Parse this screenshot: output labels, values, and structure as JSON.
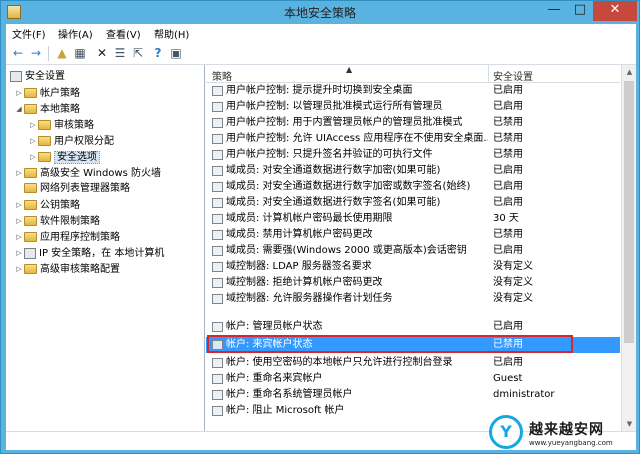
{
  "window": {
    "title": "本地安全策略",
    "min_glyph": "—",
    "max_glyph": "□",
    "close_glyph": "✕"
  },
  "menu": [
    "文件(F)",
    "操作(A)",
    "查看(V)",
    "帮助(H)"
  ],
  "toolbar": {
    "back": "←",
    "forward": "→",
    "up": "▲",
    "view": "▦",
    "delete": "✕",
    "properties": "☰",
    "export": "⇱",
    "help": "?",
    "pane": "▣"
  },
  "tree": {
    "root": "安全设置",
    "items": [
      {
        "label": "帐户策略"
      },
      {
        "label": "本地策略"
      },
      {
        "label": "审核策略"
      },
      {
        "label": "用户权限分配"
      },
      {
        "label": "安全选项"
      },
      {
        "label": "高级安全 Windows 防火墙"
      },
      {
        "label": "网络列表管理器策略"
      },
      {
        "label": "公钥策略"
      },
      {
        "label": "软件限制策略"
      },
      {
        "label": "应用程序控制策略"
      },
      {
        "label": "IP 安全策略，在 本地计算机"
      },
      {
        "label": "高级审核策略配置"
      }
    ]
  },
  "list": {
    "header_policy": "策略",
    "header_setting": "安全设置",
    "sort_glyph": "▲",
    "rows": [
      {
        "name": "用户帐户控制: 提示提升时切换到安全桌面",
        "value": "已启用"
      },
      {
        "name": "用户帐户控制: 以管理员批准模式运行所有管理员",
        "value": "已启用"
      },
      {
        "name": "用户帐户控制: 用于内置管理员帐户的管理员批准模式",
        "value": "已禁用"
      },
      {
        "name": "用户帐户控制: 允许 UIAccess 应用程序在不使用安全桌面...",
        "value": "已禁用"
      },
      {
        "name": "用户帐户控制: 只提升签名并验证的可执行文件",
        "value": "已禁用"
      },
      {
        "name": "域成员: 对安全通道数据进行数字加密(如果可能)",
        "value": "已启用"
      },
      {
        "name": "域成员: 对安全通道数据进行数字加密或数字签名(始终)",
        "value": "已启用"
      },
      {
        "name": "域成员: 对安全通道数据进行数字签名(如果可能)",
        "value": "已启用"
      },
      {
        "name": "域成员: 计算机帐户密码最长使用期限",
        "value": "30 天"
      },
      {
        "name": "域成员: 禁用计算机帐户密码更改",
        "value": "已禁用"
      },
      {
        "name": "域成员: 需要强(Windows 2000 或更高版本)会话密钥",
        "value": "已启用"
      },
      {
        "name": "域控制器: LDAP 服务器签名要求",
        "value": "没有定义"
      },
      {
        "name": "域控制器: 拒绝计算机帐户密码更改",
        "value": "没有定义"
      },
      {
        "name": "域控制器: 允许服务器操作者计划任务",
        "value": "没有定义"
      },
      {
        "name": "帐户: 管理员帐户状态",
        "value": "已启用"
      },
      {
        "name": "帐户: 来宾帐户状态",
        "value": "已禁用"
      },
      {
        "name": "帐户: 使用空密码的本地帐户只允许进行控制台登录",
        "value": "已启用"
      },
      {
        "name": "帐户: 重命名来宾帐户",
        "value": "Guest"
      },
      {
        "name": "帐户: 重命名系统管理员帐户",
        "value": "dministrator"
      },
      {
        "name": "帐户: 阻止 Microsoft 帐户",
        "value": ""
      }
    ]
  },
  "scroll": {
    "up": "▲",
    "down": "▼"
  },
  "watermark": {
    "logo": "Y",
    "text": "越来越安网",
    "url": "www.yueyangbang.com"
  }
}
